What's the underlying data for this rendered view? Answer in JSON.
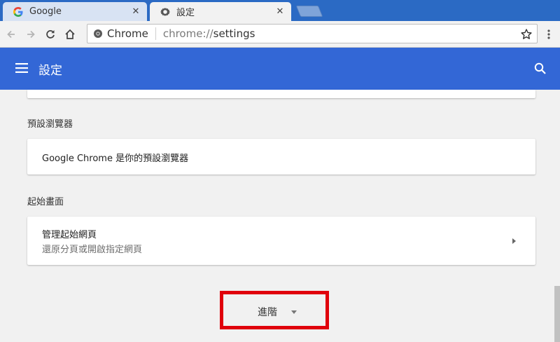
{
  "tabs": [
    {
      "title": "Google",
      "icon": "google-g-icon",
      "close": "✕"
    },
    {
      "title": "設定",
      "icon": "gear-icon",
      "close": "✕"
    }
  ],
  "toolbar": {
    "omnibox_chip": "Chrome",
    "url_scheme": "chrome://",
    "url_host": "settings"
  },
  "header": {
    "title": "設定"
  },
  "sections": {
    "default_browser": {
      "heading": "預設瀏覽器",
      "text": "Google Chrome 是你的預設瀏覽器"
    },
    "startup": {
      "heading": "起始畫面",
      "title": "管理起始網頁",
      "subtitle": "還原分頁或開啟指定網頁"
    }
  },
  "advanced": {
    "label": "進階"
  },
  "colors": {
    "tabstrip": "#2b6ac4",
    "header": "#3367d6",
    "highlight": "#e0000c"
  }
}
